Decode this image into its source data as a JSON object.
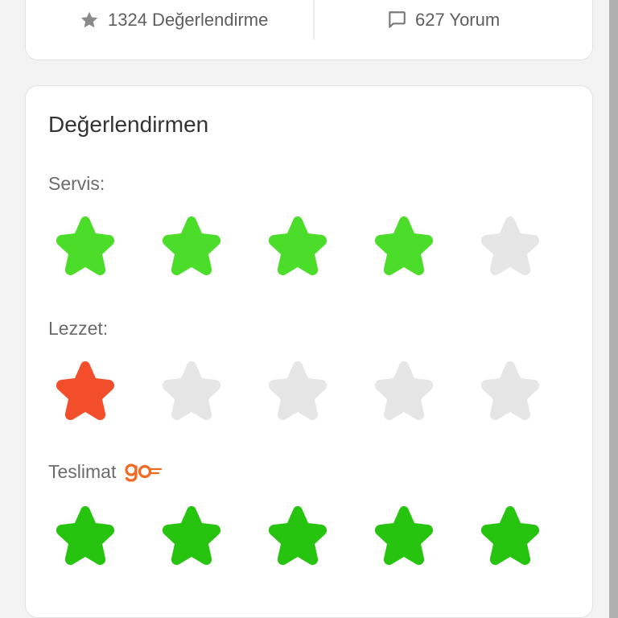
{
  "stats": {
    "ratings_text": "1324 Değerlendirme",
    "comments_text": "627 Yorum",
    "icons": [
      "star-icon",
      "comment-icon"
    ]
  },
  "rating_card": {
    "title": "Değerlendirmen",
    "sections": [
      {
        "key": "service",
        "label": "Servis:",
        "value": 4,
        "max": 5,
        "color": "#4bdd2a"
      },
      {
        "key": "taste",
        "label": "Lezzet:",
        "value": 1,
        "max": 5,
        "color": "#f24e2b"
      },
      {
        "key": "delivery",
        "label": "Teslimat",
        "value": 5,
        "max": 5,
        "color": "#27c40f",
        "logo": "go-logo",
        "logo_text": "go"
      }
    ]
  },
  "colors": {
    "empty_star": "#e6e6e6",
    "service_green": "#4bdd2a",
    "taste_red": "#f24e2b",
    "delivery_green": "#27c40f",
    "go_orange": "#f26a21"
  }
}
